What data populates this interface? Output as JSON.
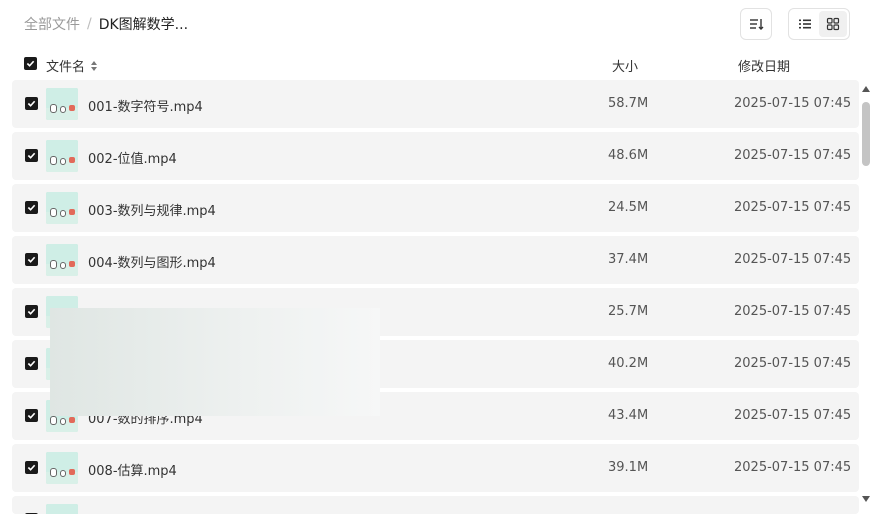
{
  "breadcrumb": {
    "root": "全部文件",
    "separator": "/",
    "current": "DK图解数学..."
  },
  "toolbar": {
    "sort_icon": "sort-icon",
    "list_view_icon": "list-view-icon",
    "grid_view_icon": "grid-view-icon"
  },
  "columns": {
    "name": "文件名",
    "size": "大小",
    "modified": "修改日期"
  },
  "files": [
    {
      "name": "001-数字符号.mp4",
      "size": "58.7M",
      "modified": "2025-07-15 07:45",
      "checked": true
    },
    {
      "name": "002-位值.mp4",
      "size": "48.6M",
      "modified": "2025-07-15 07:45",
      "checked": true
    },
    {
      "name": "003-数列与规律.mp4",
      "size": "24.5M",
      "modified": "2025-07-15 07:45",
      "checked": true
    },
    {
      "name": "004-数列与图形.mp4",
      "size": "37.4M",
      "modified": "2025-07-15 07:45",
      "checked": true
    },
    {
      "name": "",
      "size": "25.7M",
      "modified": "2025-07-15 07:45",
      "checked": true
    },
    {
      "name": "",
      "size": "40.2M",
      "modified": "2025-07-15 07:45",
      "checked": true
    },
    {
      "name": "007-数的排序.mp4",
      "size": "43.4M",
      "modified": "2025-07-15 07:45",
      "checked": true
    },
    {
      "name": "008-估算.mp4",
      "size": "39.1M",
      "modified": "2025-07-15 07:45",
      "checked": true
    },
    {
      "name": "",
      "size": "",
      "modified": "",
      "checked": true
    }
  ],
  "colors": {
    "row_bg": "#f4f4f4",
    "checkbox": "#1a1a1a",
    "muted_text": "#9a9a9a"
  }
}
